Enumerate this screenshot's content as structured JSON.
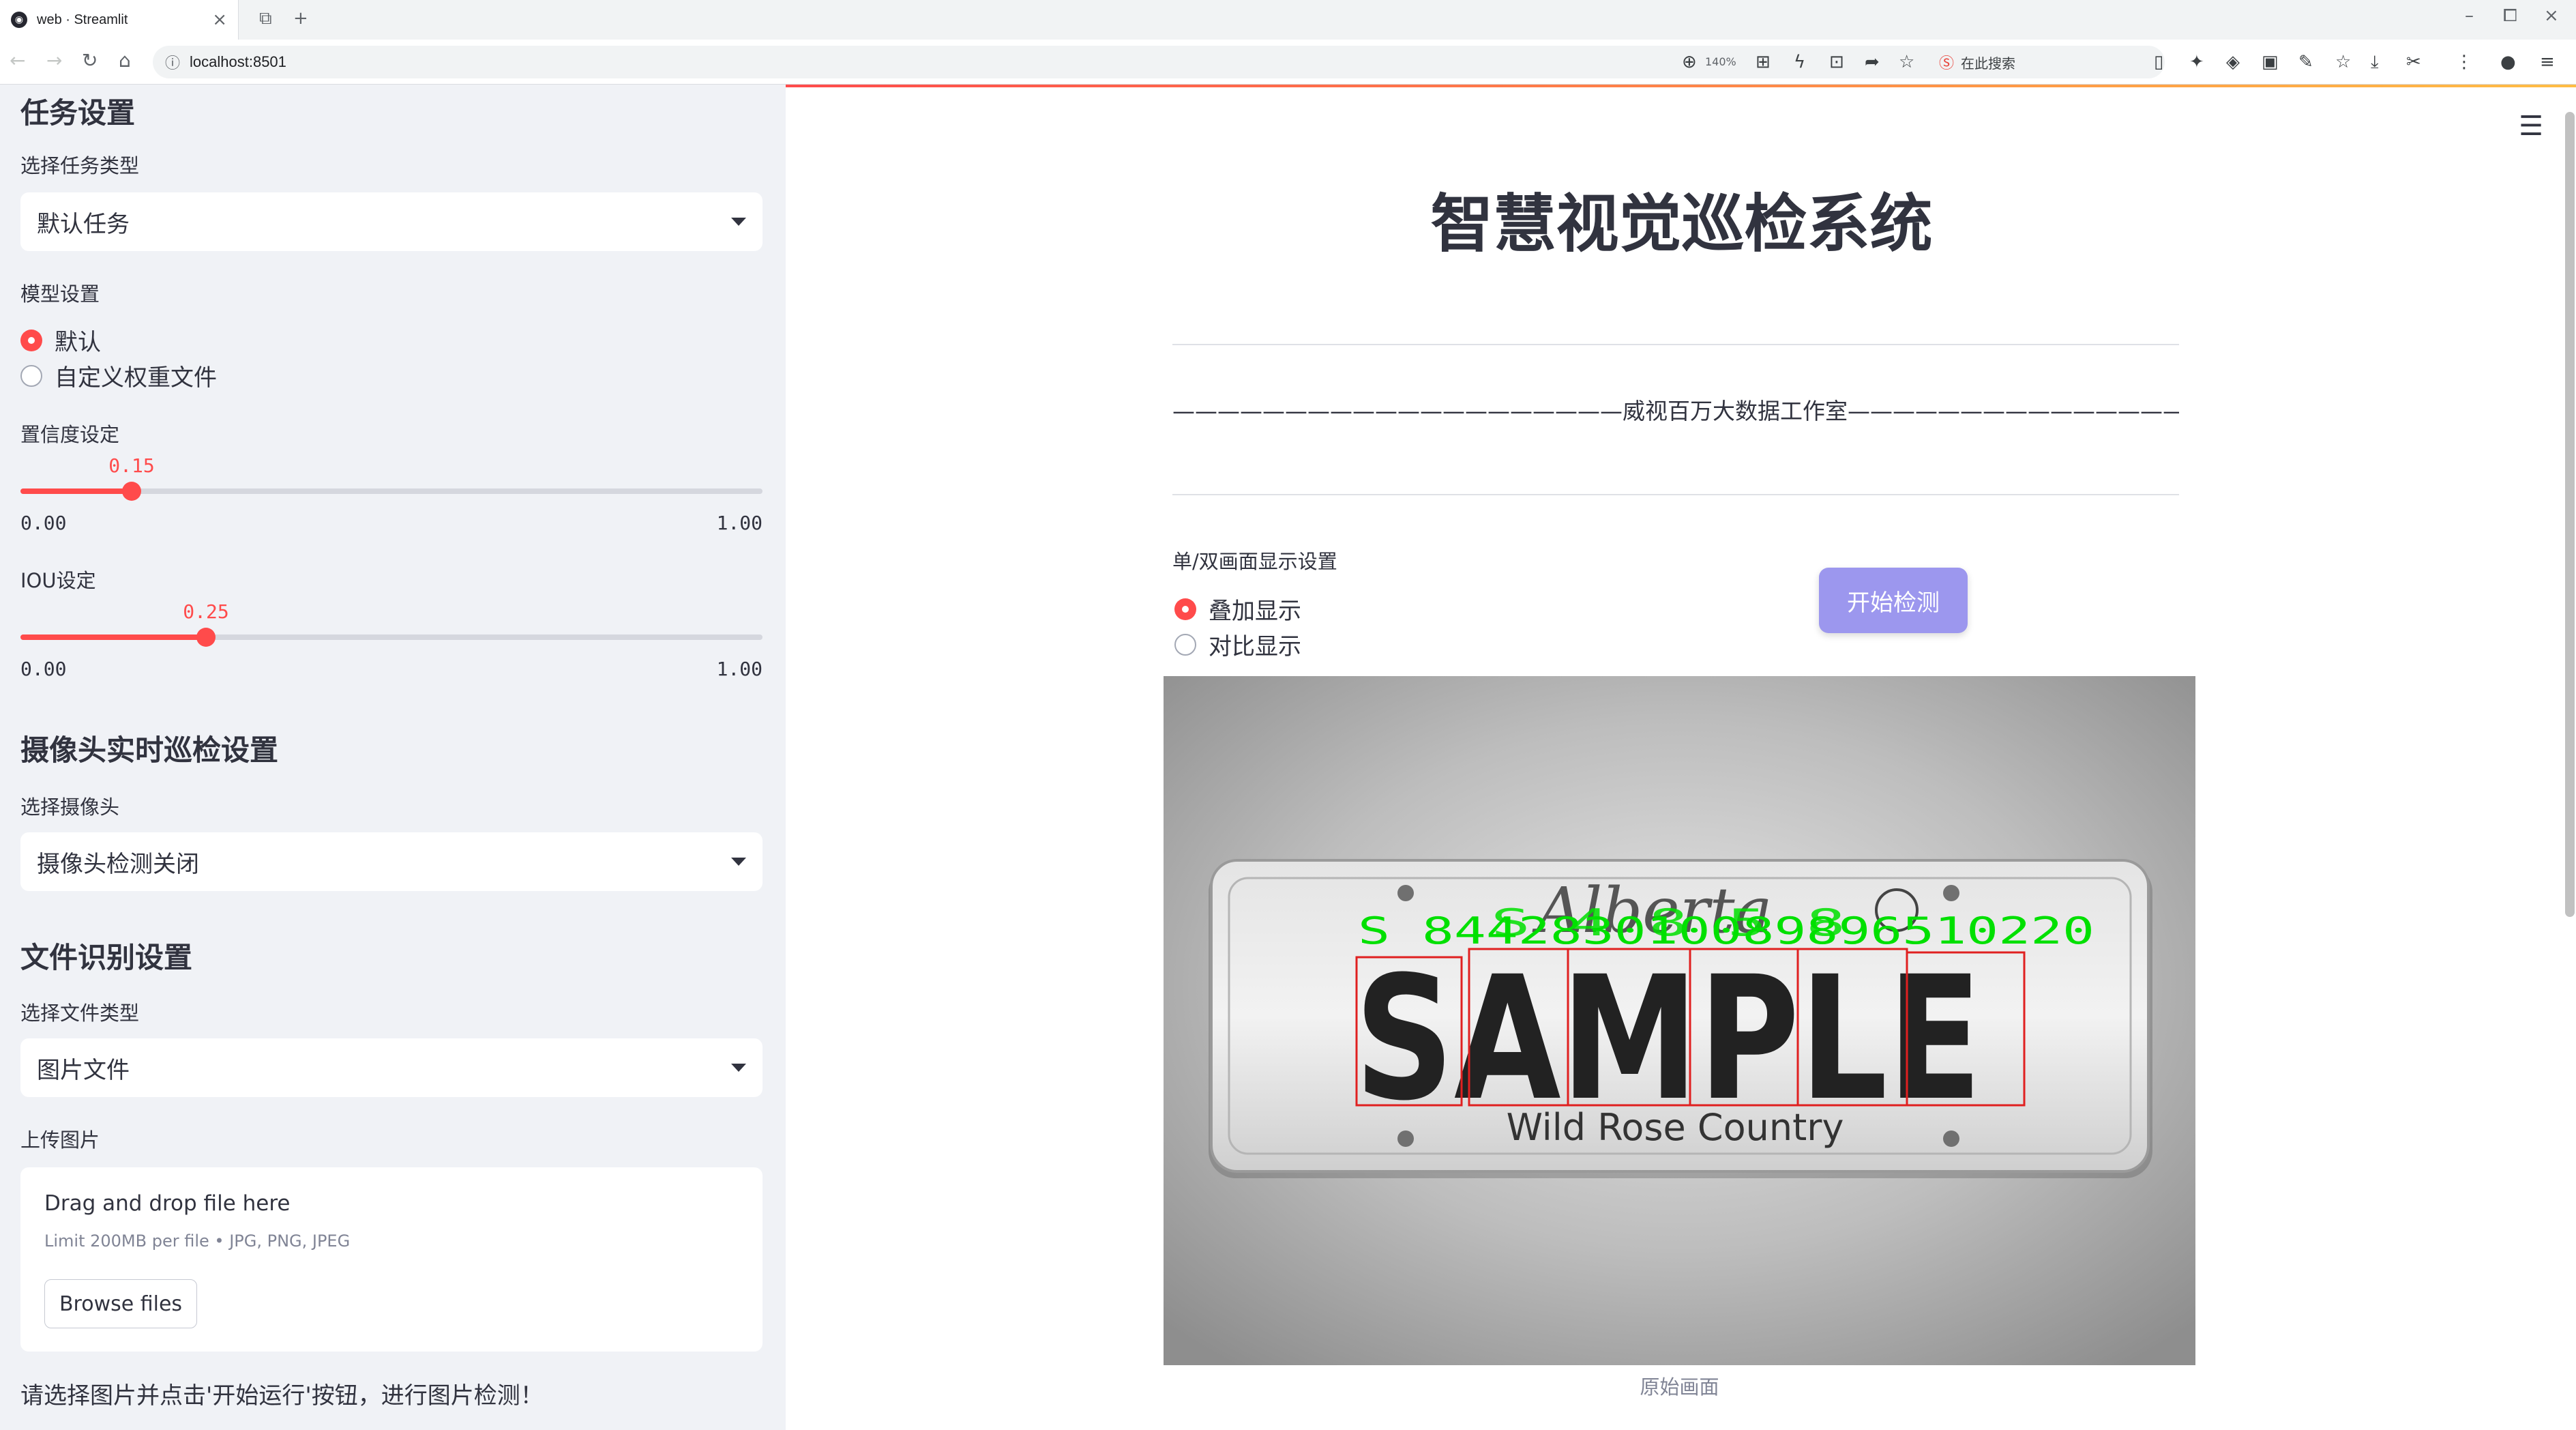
{
  "browser": {
    "tab_title": "web · Streamlit",
    "url": "localhost:8501",
    "zoom": "140%",
    "search_placeholder": "在此搜索"
  },
  "sidebar": {
    "task_heading": "任务设置",
    "task_type_label": "选择任务类型",
    "task_type_value": "默认任务",
    "model_label": "模型设置",
    "model_options": [
      "默认",
      "自定义权重文件"
    ],
    "model_selected": "默认",
    "confidence_label": "置信度设定",
    "confidence": {
      "value": "0.15",
      "min": "0.00",
      "max": "1.00",
      "fraction": 0.15
    },
    "iou_label": "IOU设定",
    "iou": {
      "value": "0.25",
      "min": "0.00",
      "max": "1.00",
      "fraction": 0.25
    },
    "camera_heading": "摄像头实时巡检设置",
    "camera_label": "选择摄像头",
    "camera_value": "摄像头检测关闭",
    "file_heading": "文件识别设置",
    "file_type_label": "选择文件类型",
    "file_type_value": "图片文件",
    "upload_label": "上传图片",
    "upload_title": "Drag and drop file here",
    "upload_limit": "Limit 200MB per file • JPG, PNG, JPEG",
    "browse_label": "Browse files",
    "footer_hint": "请选择图片并点击'开始运行'按钮，进行图片检测！"
  },
  "main": {
    "title": "智慧视觉巡检系统",
    "studio_line": "————————————————————威视百万大数据工作室——————————————————————",
    "display_label": "单/双画面显示设置",
    "display_options": [
      "叠加显示",
      "对比显示"
    ],
    "display_selected": "叠加显示",
    "start_button": "开始检测",
    "image_caption": "原始画面",
    "plate": {
      "top_text": "Alberta",
      "main_text": "SAMPLE",
      "bottom_text": "Wild Rose Country",
      "detections_text": "S 844283010089896510220",
      "detection_overlay_extra": "S 4 8 5 8",
      "box_color": "#e02020",
      "label_color": "#00e000"
    }
  }
}
